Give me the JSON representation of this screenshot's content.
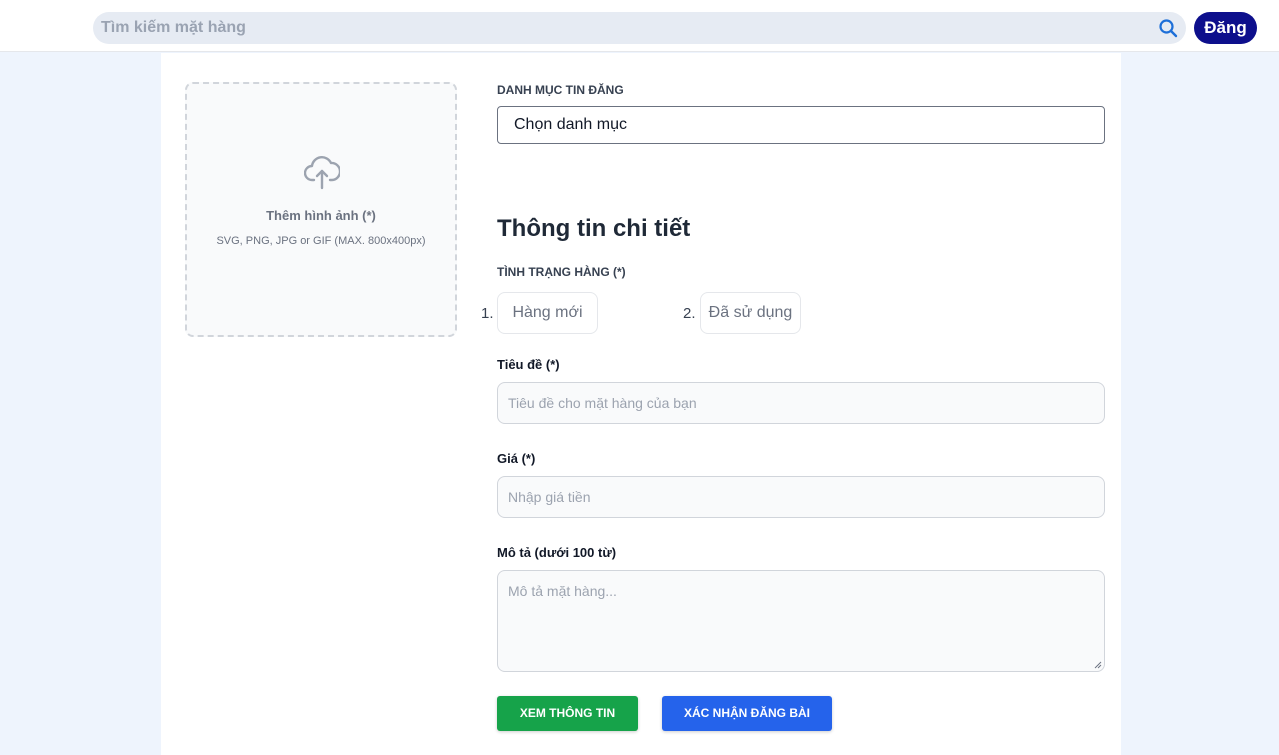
{
  "header": {
    "search_placeholder": "Tìm kiếm mặt hàng",
    "post_button": "Đăng"
  },
  "upload": {
    "title": "Thêm hình ảnh (*)",
    "hint": "SVG, PNG, JPG or GIF (MAX. 800x400px)"
  },
  "category": {
    "label": "DANH MỤC TIN ĐĂNG",
    "selected": "Chọn danh mục"
  },
  "details": {
    "heading": "Thông tin chi tiết",
    "condition_label": "TÌNH TRẠNG HÀNG (*)",
    "conditions": [
      {
        "num": "1.",
        "label": "Hàng mới"
      },
      {
        "num": "2.",
        "label": "Đã sử dụng"
      }
    ],
    "title_label": "Tiêu đề (*)",
    "title_placeholder": "Tiêu đề cho mặt hàng của bạn",
    "price_label": "Giá (*)",
    "price_placeholder": "Nhập giá tiền",
    "desc_label": "Mô tả (dưới 100 từ)",
    "desc_placeholder": "Mô tả mặt hàng..."
  },
  "actions": {
    "view": "XEM THÔNG TIN",
    "submit": "XÁC NHẬN ĐĂNG BÀI"
  },
  "colors": {
    "post_button": "#0d0f8c",
    "view_button": "#16a34a",
    "submit_button": "#2563eb",
    "search_icon": "#1d6fd8"
  }
}
